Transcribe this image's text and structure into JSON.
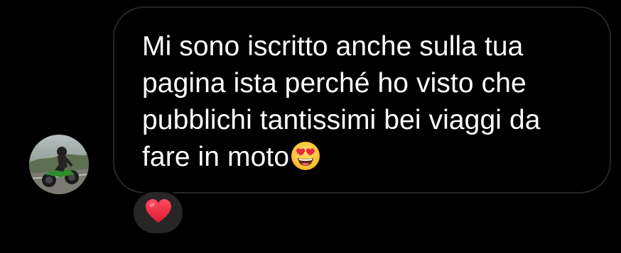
{
  "conversation": {
    "avatar": {
      "icon": "motorcycle-rider-photo"
    },
    "message": {
      "lines": [
        "Mi sono iscritto anche sulla tua",
        "pagina ista perché ho visto che",
        "pubblichi tantissimi bei viaggi da",
        "fare in moto"
      ],
      "emoji": "heart-eyes-emoji",
      "bubble_border_color": "#262626",
      "text_color": "#ffffff"
    },
    "reaction": {
      "icon": "red-heart-emoji",
      "background_color": "#262626",
      "color": "#e0245e"
    }
  }
}
